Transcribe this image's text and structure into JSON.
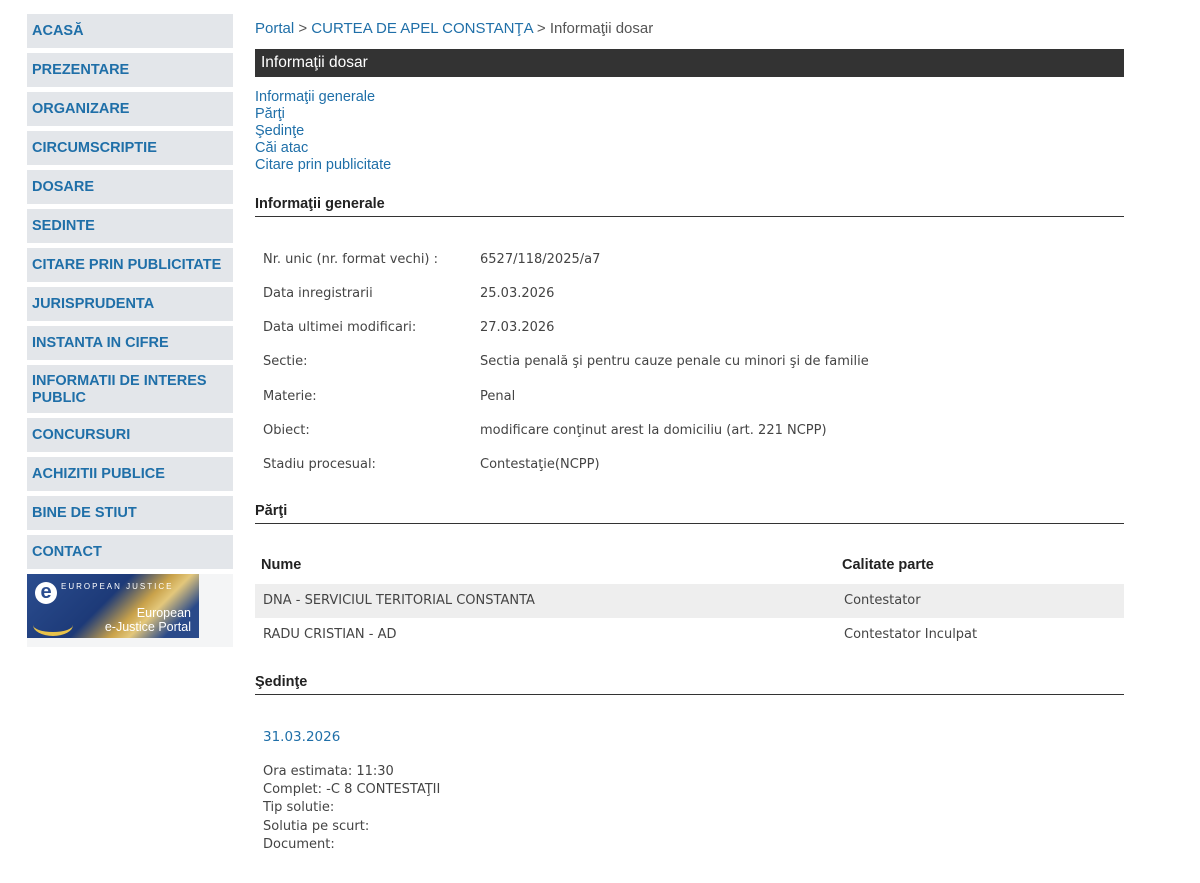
{
  "sidebar": {
    "items": [
      {
        "label": "ACASĂ"
      },
      {
        "label": "PREZENTARE"
      },
      {
        "label": "ORGANIZARE"
      },
      {
        "label": "CIRCUMSCRIPTIE"
      },
      {
        "label": "DOSARE"
      },
      {
        "label": "SEDINTE"
      },
      {
        "label": "CITARE PRIN PUBLICITATE"
      },
      {
        "label": "JURISPRUDENTA"
      },
      {
        "label": "INSTANTA IN CIFRE"
      },
      {
        "label": "INFORMATII DE INTERES PUBLIC"
      },
      {
        "label": "CONCURSURI"
      },
      {
        "label": "ACHIZITII PUBLICE"
      },
      {
        "label": "BINE DE STIUT"
      },
      {
        "label": "CONTACT"
      }
    ],
    "banner": {
      "small": "EUROPEAN JUSTICE",
      "line1": "European",
      "line2": "e-Justice Portal"
    }
  },
  "breadcrumb": {
    "home": "Portal",
    "sep1": ">",
    "court": "CURTEA DE APEL CONSTANŢA",
    "sep2": ">",
    "current": "Informaţii dosar"
  },
  "page_title": "Informaţii dosar",
  "anchors": [
    "Informaţii generale",
    "Părţi",
    "Şedinţe",
    "Căi atac",
    "Citare prin publicitate"
  ],
  "general": {
    "heading": "Informaţii generale",
    "rows": [
      {
        "label": "Nr. unic (nr. format vechi) :",
        "value": "6527/118/2025/a7"
      },
      {
        "label": "Data inregistrarii",
        "value": "25.03.2026"
      },
      {
        "label": "Data ultimei modificari:",
        "value": "27.03.2026"
      },
      {
        "label": "Sectie:",
        "value": "Sectia penală şi pentru cauze penale cu minori şi de familie"
      },
      {
        "label": "Materie:",
        "value": "Penal"
      },
      {
        "label": "Obiect:",
        "value": "modificare conţinut arest la domiciliu (art. 221 NCPP)"
      },
      {
        "label": "Stadiu procesual:",
        "value": "Contestaţie(NCPP)"
      }
    ]
  },
  "parti": {
    "heading": "Părţi",
    "col_name": "Nume",
    "col_role": "Calitate parte",
    "rows": [
      {
        "name": "DNA - SERVICIUL TERITORIAL CONSTANTA",
        "role": "Contestator"
      },
      {
        "name": "RADU CRISTIAN - AD",
        "role": "Contestator Inculpat"
      }
    ]
  },
  "sedinte": {
    "heading": "Şedinţe",
    "date": "31.03.2026",
    "details": [
      "Ora estimata: 11:30",
      "Complet: -C 8 CONTESTAŢII",
      "Tip solutie:",
      "Solutia pe scurt:",
      "Document:"
    ]
  }
}
